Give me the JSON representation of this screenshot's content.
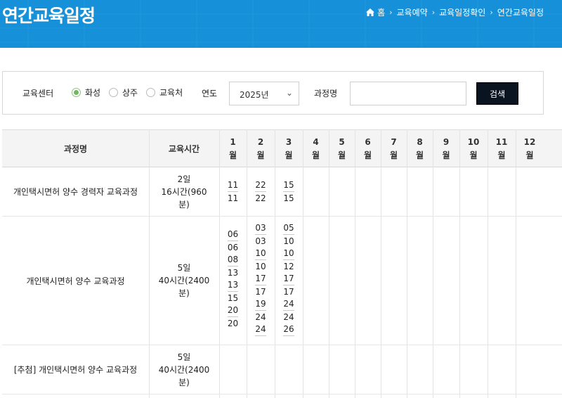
{
  "header": {
    "title": "연간교육일정",
    "breadcrumb": [
      "홈",
      "교육예약",
      "교육일정확인",
      "연간교육일정"
    ]
  },
  "search": {
    "center_label": "교육센터",
    "centers": [
      {
        "label": "화성",
        "selected": true
      },
      {
        "label": "상주",
        "selected": false
      },
      {
        "label": "교육처",
        "selected": false
      }
    ],
    "year_label": "연도",
    "year_value": "2025년",
    "course_label": "과정명",
    "course_value": "",
    "search_button": "검색"
  },
  "table": {
    "col_course": "과정명",
    "col_time": "교육시간",
    "months": [
      {
        "num": "1",
        "unit": "월"
      },
      {
        "num": "2",
        "unit": "월"
      },
      {
        "num": "3",
        "unit": "월"
      },
      {
        "num": "4",
        "unit": "월"
      },
      {
        "num": "5",
        "unit": "월"
      },
      {
        "num": "6",
        "unit": "월"
      },
      {
        "num": "7",
        "unit": "월"
      },
      {
        "num": "8",
        "unit": "월"
      },
      {
        "num": "9",
        "unit": "월"
      },
      {
        "num": "10",
        "unit": "월"
      },
      {
        "num": "11",
        "unit": "월"
      },
      {
        "num": "12",
        "unit": "월"
      }
    ],
    "rows": [
      {
        "course": "개인택시면허 양수 경력자 교육과정",
        "time": [
          "2일",
          "16시간(960",
          "분)"
        ],
        "schedule": [
          [
            [
              "11",
              "11"
            ]
          ],
          [
            [
              "22",
              "22"
            ]
          ],
          [
            [
              "15",
              "15"
            ]
          ]
        ]
      },
      {
        "course": "개인택시면허 양수 교육과정",
        "time": [
          "5일",
          "40시간(2400",
          "분)"
        ],
        "schedule": [
          [
            [
              "06",
              "06"
            ],
            [
              "08",
              "13"
            ],
            [
              "13",
              "15"
            ],
            [
              "20",
              "20"
            ]
          ],
          [
            [
              "03",
              "03"
            ],
            [
              "10",
              "10"
            ],
            [
              "17",
              "17"
            ],
            [
              "19",
              "24"
            ],
            [
              "24"
            ]
          ],
          [
            [
              "05",
              "10"
            ],
            [
              "10",
              "12"
            ],
            [
              "17",
              "17"
            ],
            [
              "24",
              "24"
            ],
            [
              "26"
            ]
          ]
        ]
      },
      {
        "course": "[추첨] 개인택시면허 양수 교육과정",
        "time": [
          "5일",
          "40시간(2400",
          "분)"
        ],
        "schedule": []
      }
    ]
  }
}
